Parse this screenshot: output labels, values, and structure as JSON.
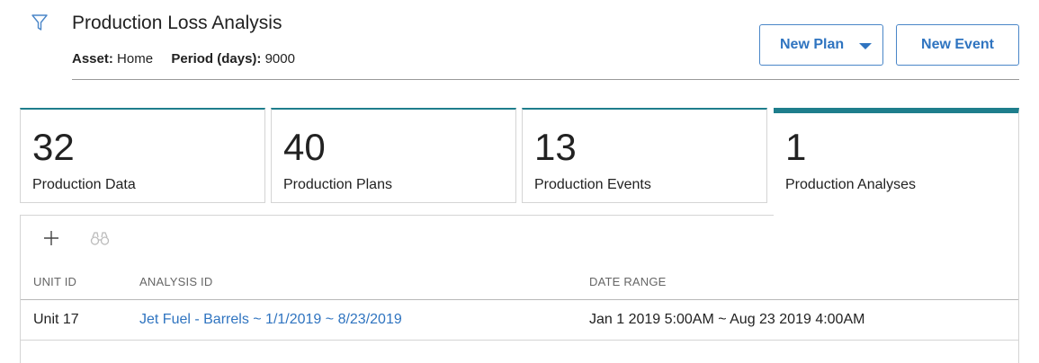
{
  "header": {
    "title": "Production Loss Analysis",
    "asset_label": "Asset:",
    "asset_value": "Home",
    "period_label": "Period (days):",
    "period_value": "9000",
    "filter_icon": "filter-icon"
  },
  "actions": {
    "new_plan": "New Plan",
    "new_event": "New Event"
  },
  "tiles": [
    {
      "count": "32",
      "label": "Production Data"
    },
    {
      "count": "40",
      "label": "Production Plans"
    },
    {
      "count": "13",
      "label": "Production Events"
    },
    {
      "count": "1",
      "label": "Production Analyses",
      "active": true
    }
  ],
  "toolbar": {
    "icons": [
      "plus-icon",
      "binoculars-icon"
    ]
  },
  "table": {
    "columns": [
      "UNIT ID",
      "ANALYSIS ID",
      "DATE RANGE"
    ],
    "rows": [
      [
        "Unit 17",
        "Jet Fuel - Barrels ~ 1/1/2019 ~ 8/23/2019",
        "Jan 1 2019 5:00AM ~ Aug 23 2019 4:00AM"
      ]
    ]
  },
  "colors": {
    "accent_teal": "#1e7e8c",
    "link_blue": "#2f74c0"
  }
}
